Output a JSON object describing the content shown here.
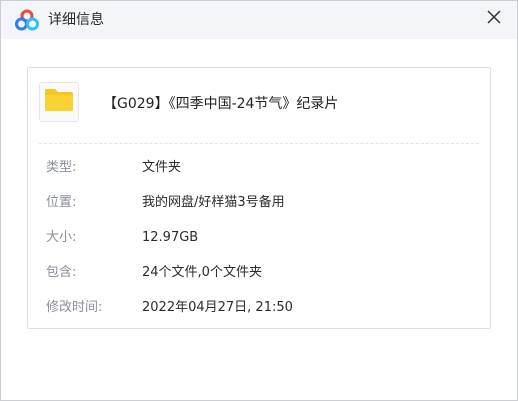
{
  "window": {
    "title": "详细信息",
    "logo_icon": "baidu-netdisk-cloud-icon",
    "close_icon": "close-icon"
  },
  "file": {
    "icon": "folder-icon",
    "name": "【G029】《四季中国-24节气》纪录片"
  },
  "details": [
    {
      "label": "类型:",
      "value": "文件夹"
    },
    {
      "label": "位置:",
      "value": "我的网盘/好样猫3号备用"
    },
    {
      "label": "大小:",
      "value": "12.97GB"
    },
    {
      "label": "包含:",
      "value": "24个文件,0个文件夹"
    },
    {
      "label": "修改时间:",
      "value": "2022年04月27日, 21:50"
    }
  ],
  "colors": {
    "logo_red": "#e84a3b",
    "logo_blue": "#2e7cf6",
    "folder_yellow": "#f7c623",
    "titlebar_bg": "#f3f5f9"
  }
}
